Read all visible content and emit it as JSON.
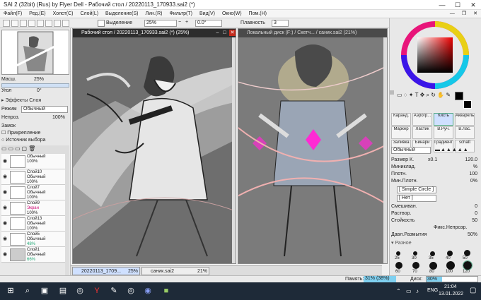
{
  "title": "SAI 2 (32bit) (Rus) by Flyer Dell - Рабочий стол / 20220113_170933.sai2 (*)",
  "window_controls": {
    "minimize": "—",
    "maximize": "☐",
    "close": "✕"
  },
  "menu": [
    "Файл(F)",
    "Ред.(E)",
    "Холст(C)",
    "Слой(L)",
    "Выделение(S)",
    "Лин.(R)",
    "Фильтр(T)",
    "Вид(V)",
    "Окно(W)",
    "Пом.(H)"
  ],
  "toolbar": {
    "selection_label": "Выделение",
    "zoom": "25%",
    "rotation": "0.0°",
    "smoothing_label": "Плавность",
    "smoothing": "3"
  },
  "left": {
    "zoom_label": "Масш.",
    "zoom_value": "25%",
    "angle_label": "Угол",
    "angle_value": "0°",
    "effects": "Эффекты Слоя",
    "mode_label": "Режим",
    "mode_value": "Обычный",
    "opacity_label": "Непроз.",
    "opacity_value": "100%",
    "lock_label": "Замок",
    "attach": "Прикрепление",
    "source": "Источник выбора",
    "layers": [
      {
        "name": "",
        "mode": "Обычный",
        "opacity": "100%"
      },
      {
        "name": "Слой10",
        "mode": "Обычный",
        "opacity": "100%"
      },
      {
        "name": "Слой7",
        "mode": "Обычный",
        "opacity": "100%"
      },
      {
        "name": "Слой9",
        "mode": "Экран",
        "opacity": "100%"
      },
      {
        "name": "Слой13",
        "mode": "Обычный",
        "opacity": "100%"
      },
      {
        "name": "Слой5",
        "mode": "Обычный",
        "opacity": "48%"
      },
      {
        "name": "Слой1",
        "mode": "Обычный",
        "opacity": "66%"
      }
    ]
  },
  "win1": {
    "title": "Рабочий стол / 20220113_170933.sai2 (*) (25%)"
  },
  "win2": {
    "title": "Локальный диск (F:) / Скетч... / саник.sai2 (21%)"
  },
  "tabs": [
    {
      "name": "20220113_1709...",
      "zoom": "25%"
    },
    {
      "name": "саник.sai2",
      "zoom": "21%"
    }
  ],
  "tools": [
    "Каранд.",
    "Аэрогр...",
    "Кисть",
    "Акварель",
    "Маркер",
    "Ластик",
    "В.Руч.",
    "В.Лас.",
    "Заливка",
    "Бинари",
    "Градиент",
    "schatt"
  ],
  "brush": {
    "mode": "Обычный",
    "size_label": "Размер К.",
    "size_mult": "x0.1",
    "size_value": "120.0",
    "min_label": "Миниклад.",
    "min_value": "%",
    "density_label": "Плотн.",
    "density_value": "100",
    "min_density_label": "Мин.Плотн.",
    "min_density_value": "0%",
    "shape1": "[ Simple Circle ]",
    "shape2": "[ Нет ]",
    "blend_label": "Смешиван.",
    "blend_value": "0",
    "dilution_label": "Раствор.",
    "dilution_value": "0",
    "persistence_label": "Стойкость",
    "persistence_value": "50",
    "fix_opacity": "Фикс.Непрозр.",
    "blur_label": "Давл.Размытия",
    "blur_value": "50%",
    "misc": "Разное",
    "sizes": [
      "25",
      "30",
      "35",
      "40",
      "50",
      "60",
      "70",
      "80",
      "100",
      "120"
    ]
  },
  "status": {
    "memory_label": "Память:",
    "memory_value": "31% (38%)",
    "disk_label": "Диск:",
    "disk_value": "30%"
  },
  "taskbar": {
    "lang": "ENG",
    "time": "21:04",
    "date": "13.01.2022"
  },
  "colors": {
    "accent": "#e8157a",
    "selection": "#cfe0ff"
  }
}
